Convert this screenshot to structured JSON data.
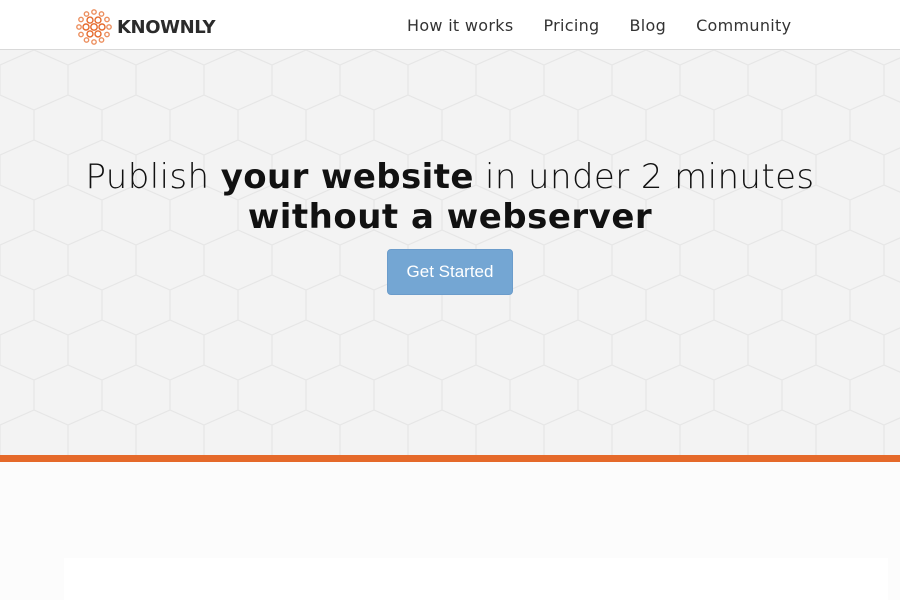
{
  "brand": {
    "name": "KNOWNLY",
    "logo_icon": "knownly-hexagon-logo-icon",
    "accent_color": "#e5692a"
  },
  "nav": {
    "items": [
      {
        "label": "How it works"
      },
      {
        "label": "Pricing"
      },
      {
        "label": "Blog"
      },
      {
        "label": "Community"
      }
    ]
  },
  "hero": {
    "line1_part1": "Publish ",
    "line1_part2": "your website",
    "line1_part3": " in under 2 minutes",
    "line2": "without a webserver",
    "cta_label": "Get Started",
    "cta_color": "#74a6d3",
    "background_color": "#f3f3f3",
    "background_pattern": "hexagon-grid"
  }
}
